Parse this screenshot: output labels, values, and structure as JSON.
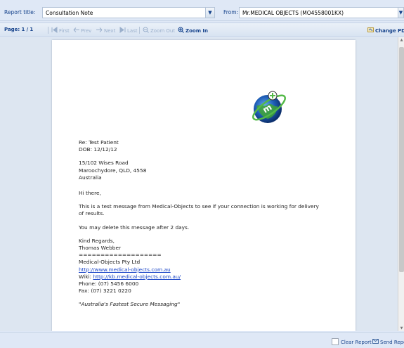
{
  "header": {
    "report_title_label": "Report title:",
    "report_title_value": "Consultation Note",
    "from_label": "From:",
    "from_value": "Mr.MEDICAL OBJECTS (MO4558001KX)"
  },
  "toolbar": {
    "page_label": "Page:",
    "page_current": "1",
    "page_sep": "/",
    "page_total": "1",
    "first": "First",
    "prev": "Prev",
    "next": "Next",
    "last": "Last",
    "zoom_out": "Zoom Out",
    "zoom_in": "Zoom In",
    "change_pdf": "Change PDF"
  },
  "document": {
    "re": "Re: Test Patient",
    "dob": "DOB: 12/12/12",
    "address1": "15/102 Wises Road",
    "address2": "Maroochydore, QLD, 4558",
    "address3": "Australia",
    "greeting": "Hi there,",
    "body1": "This is a test message from Medical-Objects to see if your connection is working for delivery",
    "body2": "of results.",
    "body3": "You may delete this message after 2 days.",
    "regards": "Kind Regards,",
    "name": "Thomas Webber",
    "divider": "===================",
    "company": "Medical-Objects Pty Ltd",
    "website": "http://www.medical-objects.com.au",
    "wiki_label": "Wiki: ",
    "wiki_link": "http://kb.medical-objects.com.au/",
    "phone": "Phone: (07) 5456 6000",
    "fax": "Fax: (07) 3221 0220",
    "tagline_open": "\"",
    "tagline": "Australia's Fastest Secure Messaging",
    "tagline_close": "\""
  },
  "footer": {
    "clear_report": "Clear Report",
    "send_report": "Send Report"
  },
  "icons": {
    "logo": "medical-objects-globe-logo"
  },
  "colors": {
    "accent": "#15428b",
    "panel": "#dfe8f6",
    "link": "#1a45c7"
  }
}
